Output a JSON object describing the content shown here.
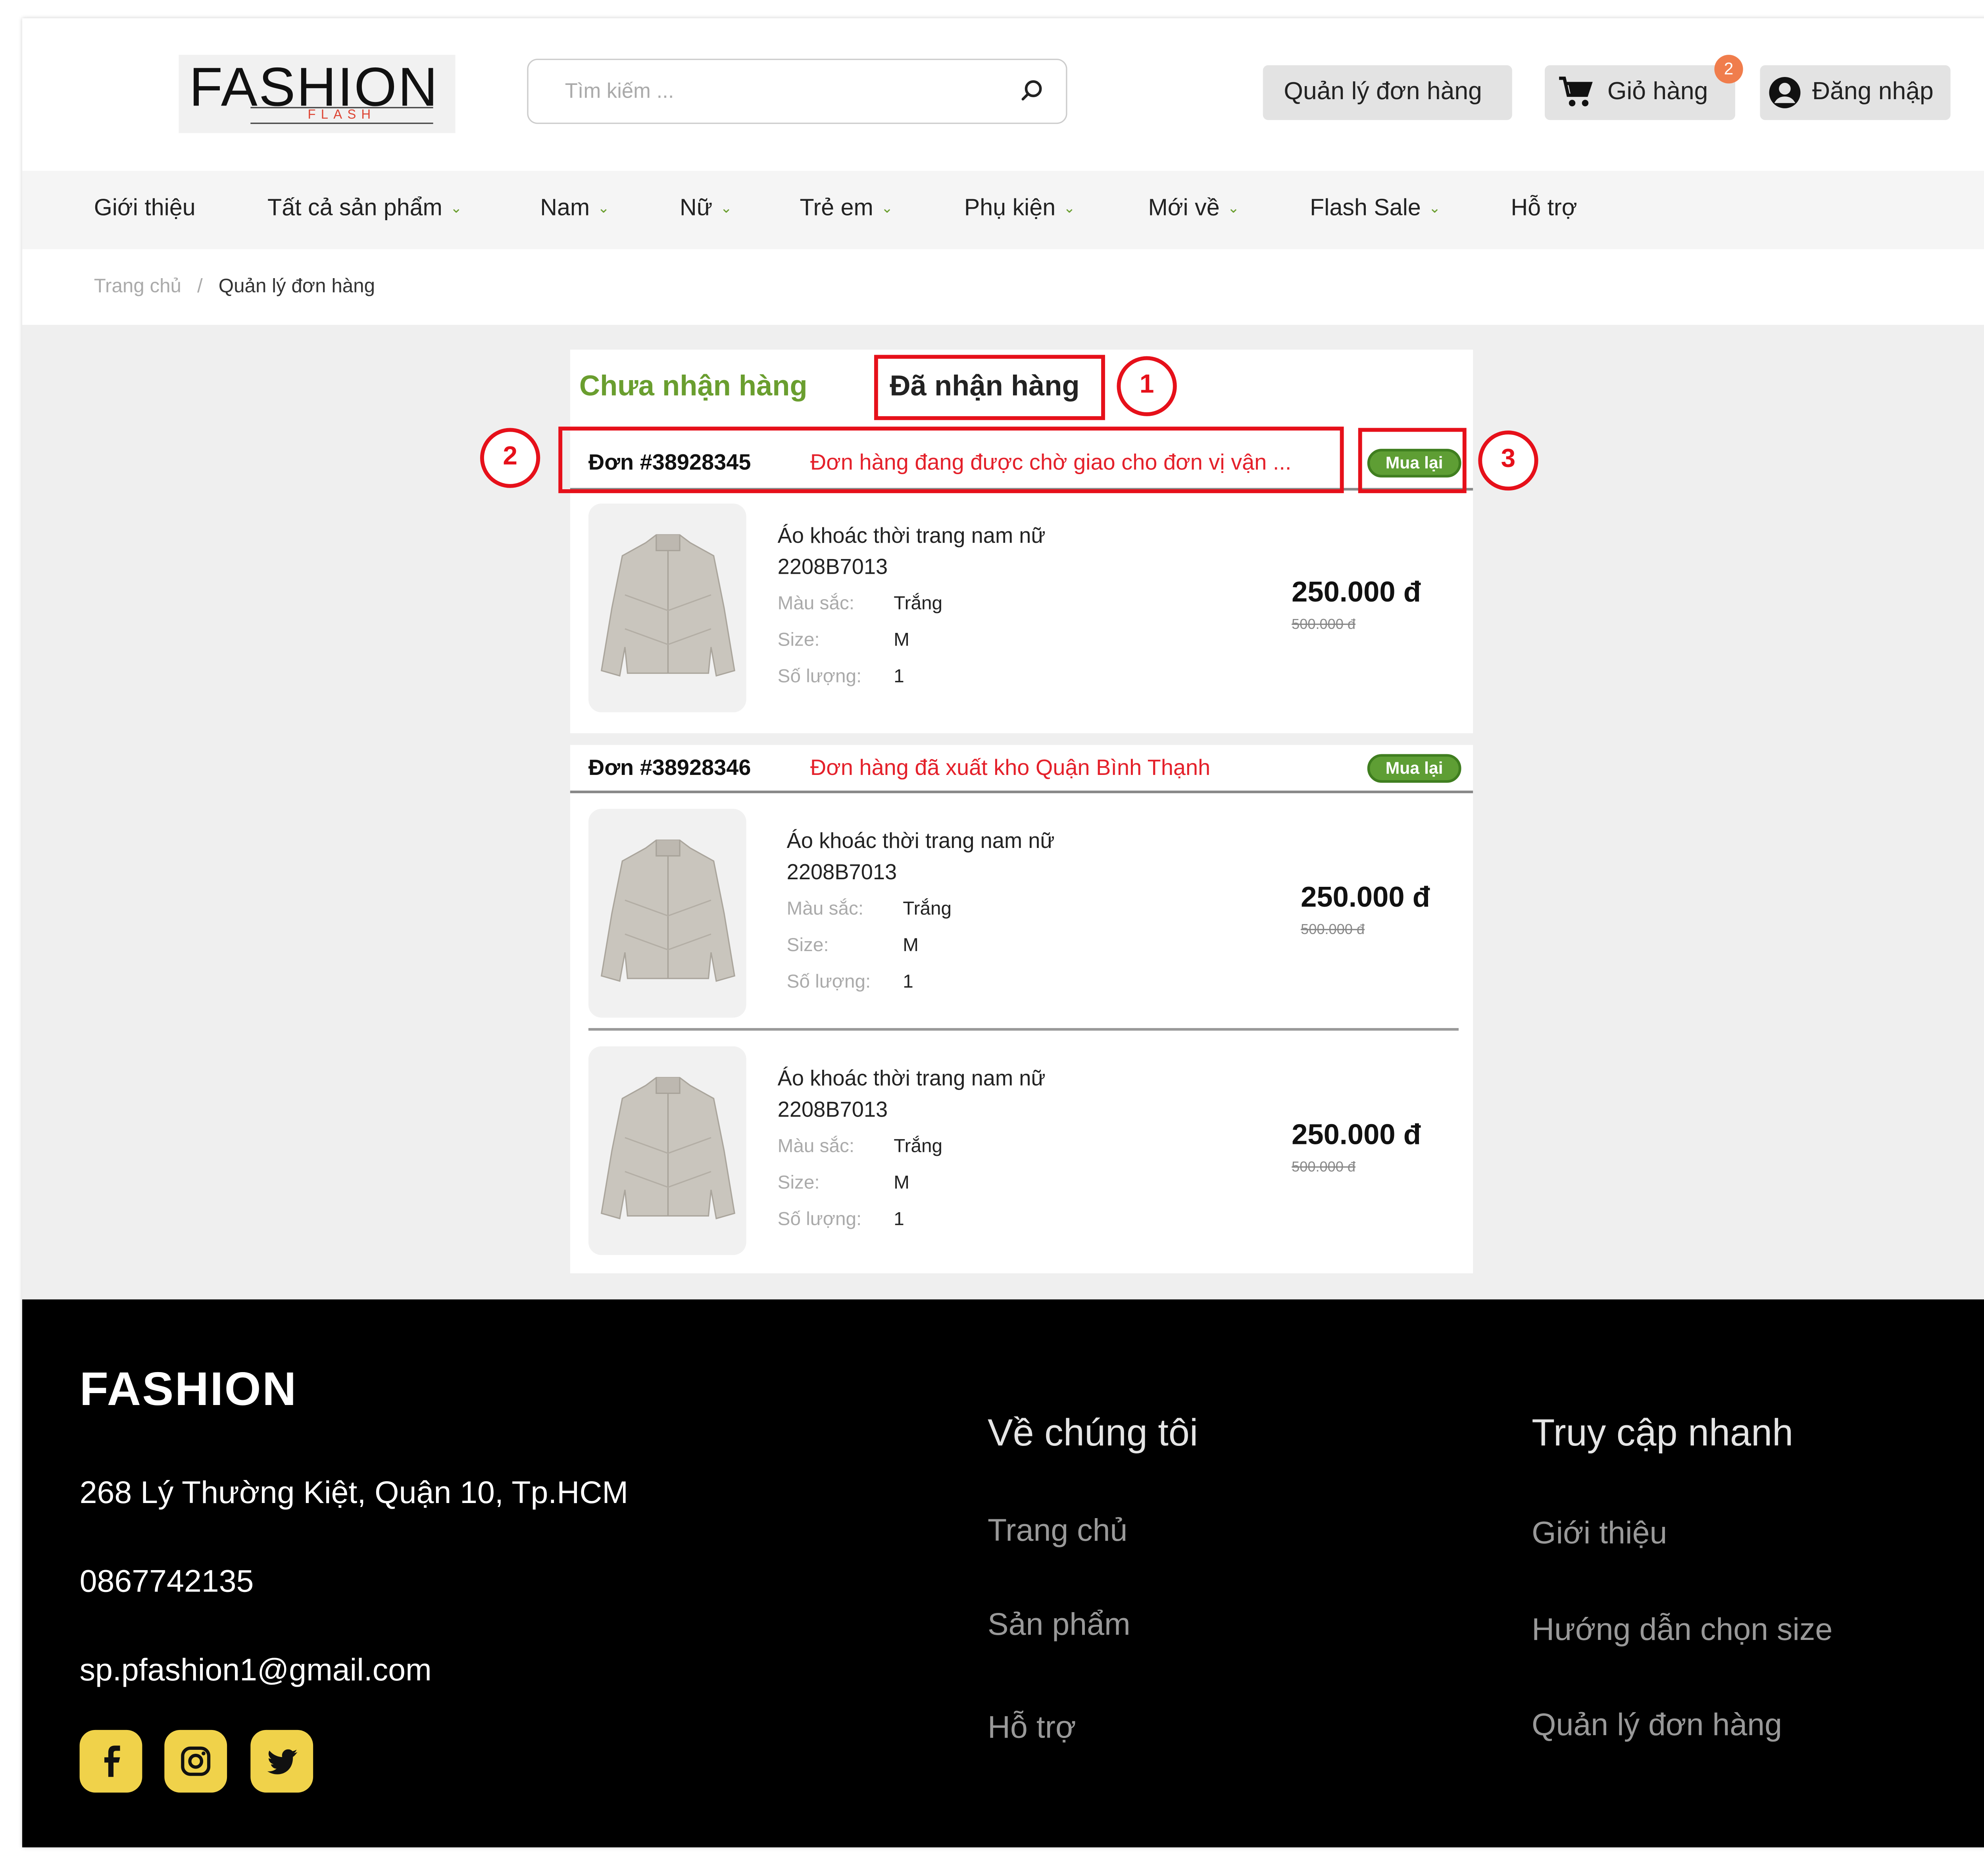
{
  "header": {
    "logo_main": "FASHION",
    "logo_sub": "FLASH",
    "search_placeholder": "Tìm kiếm ...",
    "orders_label": "Quản lý đơn hàng",
    "cart_label": "Giỏ hàng",
    "cart_count": "2",
    "login_label": "Đăng nhập"
  },
  "nav": {
    "items": [
      "Giới thiệu",
      "Tất cả sản phẩm",
      "Nam",
      "Nữ",
      "Trẻ em",
      "Phụ kiện",
      "Mới về",
      "Flash Sale",
      "Hỗ trợ"
    ]
  },
  "breadcrumb": {
    "home": "Trang chủ",
    "sep": "/",
    "current": "Quản lý đơn hàng"
  },
  "tabs": {
    "pending": "Chưa nhận hàng",
    "received": "Đã nhận hàng"
  },
  "orders": [
    {
      "id": "Đơn #38928345",
      "status": "Đơn hàng đang được chờ giao cho đơn vị vận ...",
      "rebuy": "Mua lại",
      "items": [
        {
          "name_line1": "Áo khoác thời trang nam nữ",
          "name_line2": "2208B7013",
          "color_label": "Màu sắc:",
          "color": "Trắng",
          "size_label": "Size:",
          "size": "M",
          "qty_label": "Số lượng:",
          "qty": "1",
          "price": "250.000 đ",
          "old_price": "500.000 đ"
        }
      ]
    },
    {
      "id": "Đơn #38928346",
      "status": "Đơn hàng đã xuất kho Quận Bình Thạnh",
      "rebuy": "Mua lại",
      "items": [
        {
          "name_line1": "Áo khoác thời trang nam nữ",
          "name_line2": "2208B7013",
          "color_label": "Màu sắc:",
          "color": "Trắng",
          "size_label": "Size:",
          "size": "M",
          "qty_label": "Số lượng:",
          "qty": "1",
          "price": "250.000 đ",
          "old_price": "500.000 đ"
        },
        {
          "name_line1": "Áo khoác thời trang nam nữ",
          "name_line2": "2208B7013",
          "color_label": "Màu sắc:",
          "color": "Trắng",
          "size_label": "Size:",
          "size": "M",
          "qty_label": "Số lượng:",
          "qty": "1",
          "price": "250.000 đ",
          "old_price": "500.000 đ"
        }
      ]
    }
  ],
  "annotations": [
    "1",
    "2",
    "3"
  ],
  "footer": {
    "brand": "FASHION",
    "address": "268 Lý Thường Kiệt, Quận 10, Tp.HCM",
    "phone": "0867742135",
    "email": "sp.pfashion1@gmail.com",
    "about_title": "Về chúng tôi",
    "about_links": [
      "Trang chủ",
      "Sản phẩm",
      "Hỗ trợ"
    ],
    "quick_title": "Truy cập nhanh",
    "quick_links": [
      "Giới thiệu",
      "Hướng dẫn chọn size",
      "Quản lý đơn hàng"
    ],
    "social": [
      "facebook-icon",
      "instagram-icon",
      "twitter-icon"
    ]
  },
  "colors": {
    "accent_green": "#6a9e2f",
    "status_red": "#e4202a",
    "annotation_red": "#e6101a",
    "badge_orange": "#f07d4c",
    "social_yellow": "#f0d24a"
  }
}
